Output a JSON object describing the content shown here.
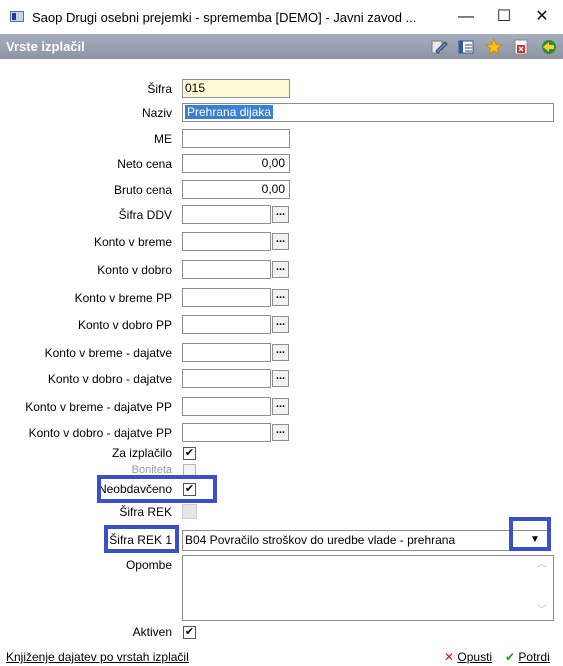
{
  "window": {
    "title": "Saop  Drugi osebni prejemki - sprememba [DEMO] - Javni zavod ...",
    "minimize": "—",
    "maximize": "☐",
    "close": "✕"
  },
  "header": {
    "title": "Vrste izplačil"
  },
  "form": {
    "sifra": {
      "label": "Šifra",
      "value": "015"
    },
    "naziv": {
      "label": "Naziv",
      "value": "Prehrana dijaka"
    },
    "me": {
      "label": "ME",
      "value": ""
    },
    "neto_cena": {
      "label": "Neto cena",
      "value": "0,00"
    },
    "bruto_cena": {
      "label": "Bruto cena",
      "value": "0,00"
    },
    "sifra_ddv": {
      "label": "Šifra DDV",
      "value": ""
    },
    "konto_v_breme": {
      "label": "Konto v breme",
      "value": ""
    },
    "konto_v_dobro": {
      "label": "Konto v dobro",
      "value": ""
    },
    "konto_v_breme_pp": {
      "label": "Konto v breme PP",
      "value": ""
    },
    "konto_v_dobro_pp": {
      "label": "Konto v dobro PP",
      "value": ""
    },
    "konto_v_breme_dajatve": {
      "label": "Konto v breme - dajatve",
      "value": ""
    },
    "konto_v_dobro_dajatve": {
      "label": "Konto v dobro - dajatve",
      "value": ""
    },
    "konto_v_breme_dajatve_pp": {
      "label": "Konto v breme - dajatve PP",
      "value": ""
    },
    "konto_v_dobro_dajatve_pp": {
      "label": "Konto v dobro - dajatve PP",
      "value": ""
    },
    "za_izplacilo": {
      "label": "Za izplačilo",
      "checked": "✔"
    },
    "boniteta": {
      "label": "Boniteta",
      "checked": ""
    },
    "neobdavceno": {
      "label": "Neobdavčeno",
      "checked": "✔"
    },
    "sifra_rek": {
      "label": "Šifra REK"
    },
    "sifra_rek1": {
      "label": "Šifra REK 1",
      "value": "B04 Povračilo stroškov do uredbe vlade - prehrana"
    },
    "opombe": {
      "label": "Opombe",
      "value": ""
    },
    "aktiven": {
      "label": "Aktiven",
      "checked": "✔"
    },
    "dots": "..."
  },
  "statusbar": {
    "text": "Knjiženje dajatev po vrstah izplačil",
    "cancel_label": "Opusti",
    "confirm_label": "Potrdi"
  },
  "colors": {
    "header_bg": "#9aa1b1",
    "highlight": "#3b4fc9",
    "field_yellow": "#fffbd6",
    "selection": "#3a7fd0"
  }
}
